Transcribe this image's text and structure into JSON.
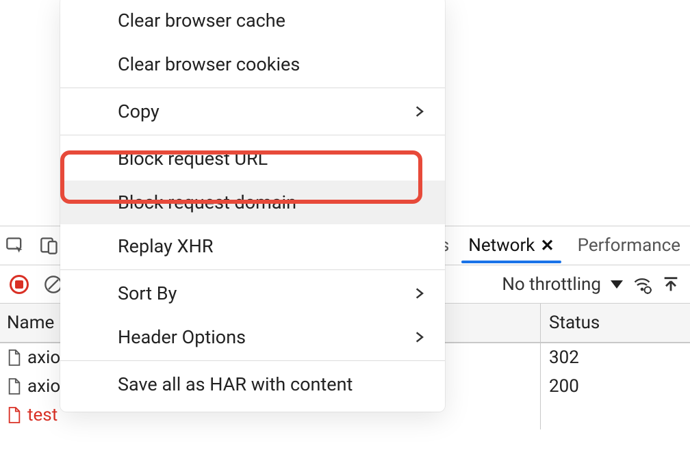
{
  "context_menu": {
    "items": [
      {
        "label": "Clear browser cache",
        "submenu": false
      },
      {
        "label": "Clear browser cookies",
        "submenu": false
      },
      {
        "sep": true
      },
      {
        "label": "Copy",
        "submenu": true
      },
      {
        "sep": true
      },
      {
        "label": "Block request URL",
        "submenu": false,
        "highlighted": true
      },
      {
        "label": "Block request domain",
        "submenu": false,
        "hover": true
      },
      {
        "label": "Replay XHR",
        "submenu": false
      },
      {
        "sep": true
      },
      {
        "label": "Sort By",
        "submenu": true
      },
      {
        "label": "Header Options",
        "submenu": true
      },
      {
        "sep": true
      },
      {
        "label": "Save all as HAR with content",
        "submenu": false
      }
    ]
  },
  "tabs": {
    "visible_partial_right": "es",
    "active_label": "Network",
    "next_label": "Performance"
  },
  "toolbar": {
    "throttling_label": "No throttling"
  },
  "network_table": {
    "columns": {
      "name": "Name",
      "status": "Status"
    },
    "rows": [
      {
        "name": "axio",
        "status": "302",
        "error": false
      },
      {
        "name": "axio",
        "status": "200",
        "error": false
      },
      {
        "name": "test",
        "status": "",
        "error": true
      }
    ]
  }
}
